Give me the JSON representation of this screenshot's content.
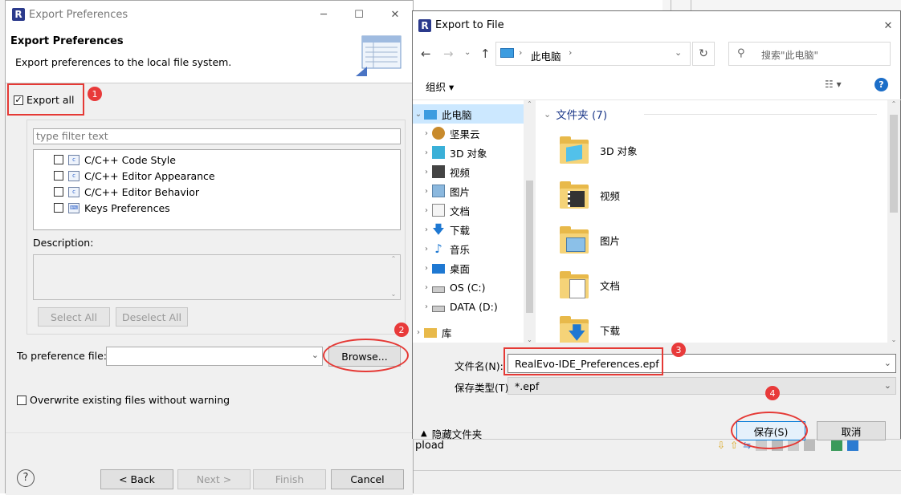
{
  "export_prefs": {
    "title": "Export Preferences",
    "header_title": "Export Preferences",
    "header_desc": "Export preferences to the local file system.",
    "export_all_label": "Export all",
    "filter_placeholder": "type filter text",
    "tree_items": [
      {
        "label": "C/C++ Code Style",
        "checked": false
      },
      {
        "label": "C/C++ Editor Appearance",
        "checked": false
      },
      {
        "label": "C/C++ Editor Behavior",
        "checked": false
      },
      {
        "label": "Keys Preferences",
        "checked": false
      }
    ],
    "description_label": "Description:",
    "select_all": "Select All",
    "deselect_all": "Deselect All",
    "to_file_label": "To preference file:",
    "to_file_value": "",
    "browse": "Browse...",
    "overwrite_label": "Overwrite existing files without warning",
    "back": "< Back",
    "next": "Next >",
    "finish": "Finish",
    "cancel": "Cancel"
  },
  "export_file": {
    "title": "Export to File",
    "breadcrumb": "此电脑",
    "search_placeholder": "搜索\"此电脑\"",
    "organize": "组织 ▾",
    "section_title": "文件夹 (7)",
    "nav_items": [
      {
        "label": "此电脑",
        "icon": "pc-icon",
        "selected": true
      },
      {
        "label": "坚果云",
        "icon": "nutstore-icon"
      },
      {
        "label": "3D 对象",
        "icon": "3d-objects-icon"
      },
      {
        "label": "视频",
        "icon": "video-icon"
      },
      {
        "label": "图片",
        "icon": "pictures-icon"
      },
      {
        "label": "文档",
        "icon": "documents-icon"
      },
      {
        "label": "下载",
        "icon": "download-icon"
      },
      {
        "label": "音乐",
        "icon": "music-icon"
      },
      {
        "label": "桌面",
        "icon": "desktop-icon"
      },
      {
        "label": "OS (C:)",
        "icon": "drive-c-icon"
      },
      {
        "label": "DATA (D:)",
        "icon": "drive-d-icon"
      },
      {
        "label": "库",
        "icon": "library-icon"
      }
    ],
    "folders": [
      "3D 对象",
      "视频",
      "图片",
      "文档",
      "下载"
    ],
    "filename_label": "文件名(N):",
    "filename_value": "RealEvo-IDE_Preferences.epf",
    "filetype_label": "保存类型(T):",
    "filetype_value": "*.epf",
    "hide_folders": "隐藏文件夹",
    "save": "保存(S)",
    "cancel": "取消"
  },
  "annotations": [
    "1",
    "2",
    "3",
    "4"
  ],
  "background": {
    "upload_fragment": "pload"
  }
}
